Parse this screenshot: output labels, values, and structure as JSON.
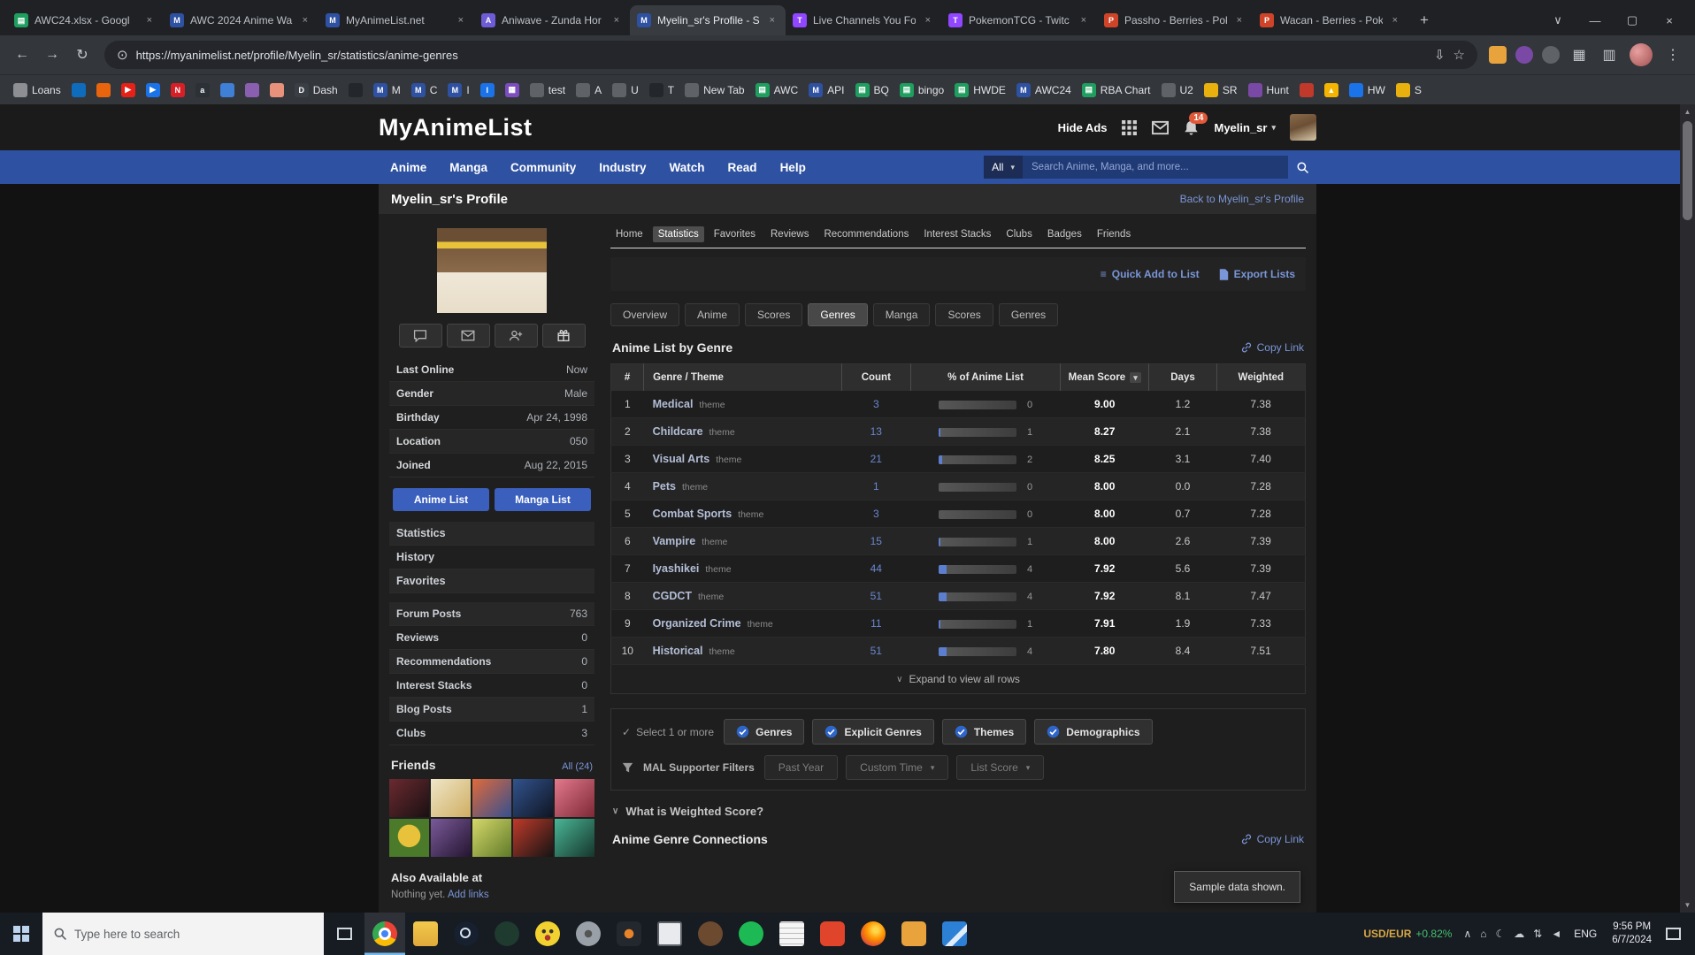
{
  "colors": {
    "mal_blue": "#2e51a2",
    "link_blue": "#7a96d8",
    "count_link": "#6988cf",
    "bar_fill": "#5b7fce",
    "badge_red": "#e05a3a",
    "ticker_gold": "#d9a945",
    "ticker_green": "#45c06e"
  },
  "icons": {
    "tab_search": "∨",
    "minimize": "—",
    "maximize": "▢",
    "close": "×",
    "back": "←",
    "forward": "→",
    "reload": "↻",
    "site_info": "⊙",
    "install": "⇩",
    "bookmark_star": "☆",
    "extensions": "▦",
    "side_panel": "▥",
    "menu": "⋮",
    "new_tab": "+",
    "overflow": "»",
    "caret_down": "▾",
    "chevron_down": "∨",
    "check": "✓",
    "quick_add": "≡",
    "scroll_up": "▲",
    "scroll_down": "▼",
    "tray_chevron": "∧",
    "tray_home": "⌂",
    "tray_moon": "☾",
    "tray_cloud": "☁",
    "tray_net": "⇅",
    "tray_volume": "◄"
  },
  "browser": {
    "tabs": [
      {
        "title": "AWC24.xlsx - Googl",
        "glyph": "▤",
        "color": "#1e9e5f",
        "active": false
      },
      {
        "title": "AWC 2024 Anime Wa",
        "glyph": "M",
        "color": "#2e51a2",
        "active": false
      },
      {
        "title": "MyAnimeList.net",
        "glyph": "M",
        "color": "#2e51a2",
        "active": false
      },
      {
        "title": "Aniwave - Zunda Hor",
        "glyph": "A",
        "color": "#6e5bd6",
        "active": false
      },
      {
        "title": "Myelin_sr's Profile - S",
        "glyph": "M",
        "color": "#2e51a2",
        "active": true
      },
      {
        "title": "Live Channels You Fo",
        "glyph": "T",
        "color": "#9146ff",
        "active": false
      },
      {
        "title": "PokemonTCG - Twitc",
        "glyph": "T",
        "color": "#9146ff",
        "active": false
      },
      {
        "title": "Passho - Berries - Pok",
        "glyph": "P",
        "color": "#cf4428",
        "active": false
      },
      {
        "title": "Wacan - Berries - Pok",
        "glyph": "P",
        "color": "#cf4428",
        "active": false
      }
    ],
    "url": "https://myanimelist.net/profile/Myelin_sr/statistics/anime-genres",
    "bookmarks": [
      {
        "label": "Loans",
        "glyph": "",
        "color": "#8d8f93"
      },
      {
        "label": "",
        "glyph": "",
        "color": "#0f6cbd"
      },
      {
        "label": "",
        "glyph": "",
        "color": "#e8650d"
      },
      {
        "label": "",
        "glyph": "▶",
        "color": "#e62117"
      },
      {
        "label": "",
        "glyph": "▶",
        "color": "#1a73e8"
      },
      {
        "label": "",
        "glyph": "N",
        "color": "#d81f26"
      },
      {
        "label": "",
        "glyph": "a",
        "color": "#2b3137"
      },
      {
        "label": "",
        "glyph": "",
        "color": "#3f7fd6"
      },
      {
        "label": "",
        "glyph": "",
        "color": "#8a5fb0"
      },
      {
        "label": "",
        "glyph": "",
        "color": "#e8927c"
      },
      {
        "label": "Dash",
        "glyph": "D",
        "color": "#3a3f45"
      },
      {
        "label": "",
        "glyph": "",
        "color": "#23272c"
      },
      {
        "label": "M",
        "glyph": "M",
        "color": "#2e51a2"
      },
      {
        "label": "C",
        "glyph": "M",
        "color": "#2e51a2"
      },
      {
        "label": "I",
        "glyph": "M",
        "color": "#2e51a2"
      },
      {
        "label": "",
        "glyph": "I",
        "color": "#1a73e8"
      },
      {
        "label": "",
        "glyph": "▦",
        "color": "#7c4dbe"
      },
      {
        "label": "test",
        "glyph": "",
        "color": "#5f6368"
      },
      {
        "label": "A",
        "glyph": "",
        "color": "#5f6368"
      },
      {
        "label": "U",
        "glyph": "",
        "color": "#5f6368"
      },
      {
        "label": "T",
        "glyph": "",
        "color": "#23272c"
      },
      {
        "label": "New Tab",
        "glyph": "",
        "color": "#5f6368"
      },
      {
        "label": "AWC",
        "glyph": "▤",
        "color": "#1e9e5f"
      },
      {
        "label": "API",
        "glyph": "M",
        "color": "#2e51a2"
      },
      {
        "label": "BQ",
        "glyph": "▤",
        "color": "#1e9e5f"
      },
      {
        "label": "bingo",
        "glyph": "▤",
        "color": "#1e9e5f"
      },
      {
        "label": "HWDE",
        "glyph": "▤",
        "color": "#1e9e5f"
      },
      {
        "label": "AWC24",
        "glyph": "M",
        "color": "#2e51a2"
      },
      {
        "label": "RBA Chart",
        "glyph": "▤",
        "color": "#1e9e5f"
      },
      {
        "label": "U2",
        "glyph": "",
        "color": "#5f6368"
      },
      {
        "label": "SR",
        "glyph": "",
        "color": "#e8b10e"
      },
      {
        "label": "Hunt",
        "glyph": "",
        "color": "#7a49a5"
      },
      {
        "label": "",
        "glyph": "",
        "color": "#c0392b"
      },
      {
        "label": "",
        "glyph": "▲",
        "color": "#f4b400"
      },
      {
        "label": "HW",
        "glyph": "",
        "color": "#1a73e8"
      },
      {
        "label": "S",
        "glyph": "",
        "color": "#e8b10e"
      }
    ],
    "bookmarks_overflow": "»"
  },
  "mal": {
    "header": {
      "logo": "MyAnimeList",
      "hide_ads": "Hide Ads",
      "notif_count": "14",
      "username": "Myelin_sr"
    },
    "nav": {
      "items": [
        "Anime",
        "Manga",
        "Community",
        "Industry",
        "Watch",
        "Read",
        "Help"
      ],
      "search_scope": "All",
      "search_placeholder": "Search Anime, Manga, and more..."
    },
    "profile_bar": {
      "title": "Myelin_sr's Profile",
      "back_link": "Back to Myelin_sr's Profile"
    },
    "sidebar": {
      "stats": [
        {
          "label": "Last Online",
          "value": "Now"
        },
        {
          "label": "Gender",
          "value": "Male"
        },
        {
          "label": "Birthday",
          "value": "Apr 24, 1998"
        },
        {
          "label": "Location",
          "value": "050"
        },
        {
          "label": "Joined",
          "value": "Aug 22, 2015"
        }
      ],
      "anime_list": "Anime List",
      "manga_list": "Manga List",
      "links": [
        "Statistics",
        "History",
        "Favorites"
      ],
      "counts": [
        {
          "label": "Forum Posts",
          "value": "763"
        },
        {
          "label": "Reviews",
          "value": "0"
        },
        {
          "label": "Recommendations",
          "value": "0"
        },
        {
          "label": "Interest Stacks",
          "value": "0"
        },
        {
          "label": "Blog Posts",
          "value": "1"
        },
        {
          "label": "Clubs",
          "value": "3"
        }
      ],
      "friends_title": "Friends",
      "friends_all": "All (24)",
      "also_available": "Also Available at",
      "nothing_yet": "Nothing yet.",
      "add_links": "Add links"
    },
    "profile_tabs": [
      {
        "label": "Home",
        "active": false
      },
      {
        "label": "Statistics",
        "active": true
      },
      {
        "label": "Favorites",
        "active": false
      },
      {
        "label": "Reviews",
        "active": false
      },
      {
        "label": "Recommendations",
        "active": false
      },
      {
        "label": "Interest Stacks",
        "active": false
      },
      {
        "label": "Clubs",
        "active": false
      },
      {
        "label": "Badges",
        "active": false
      },
      {
        "label": "Friends",
        "active": false
      }
    ],
    "toolbar": {
      "quick_add": "Quick Add to List",
      "export": "Export Lists"
    },
    "stat_tabs": [
      {
        "label": "Overview",
        "active": false
      },
      {
        "label": "Anime",
        "active": false
      },
      {
        "label": "Scores",
        "active": false
      },
      {
        "label": "Genres",
        "active": true
      },
      {
        "label": "Manga",
        "active": false
      },
      {
        "label": "Scores",
        "active": false
      },
      {
        "label": "Genres",
        "active": false
      }
    ],
    "genre_section": {
      "title": "Anime List by Genre",
      "copy_link": "Copy Link"
    },
    "table": {
      "headers": [
        "#",
        "Genre / Theme",
        "Count",
        "% of Anime List",
        "Mean Score",
        "Days",
        "Weighted"
      ],
      "rows": [
        {
          "rank": "1",
          "genre": "Medical",
          "tag": "theme",
          "count": "3",
          "percent": 0,
          "mean": "9.00",
          "days": "1.2",
          "weighted": "7.38"
        },
        {
          "rank": "2",
          "genre": "Childcare",
          "tag": "theme",
          "count": "13",
          "percent": 1,
          "mean": "8.27",
          "days": "2.1",
          "weighted": "7.38"
        },
        {
          "rank": "3",
          "genre": "Visual Arts",
          "tag": "theme",
          "count": "21",
          "percent": 2,
          "mean": "8.25",
          "days": "3.1",
          "weighted": "7.40"
        },
        {
          "rank": "4",
          "genre": "Pets",
          "tag": "theme",
          "count": "1",
          "percent": 0,
          "mean": "8.00",
          "days": "0.0",
          "weighted": "7.28"
        },
        {
          "rank": "5",
          "genre": "Combat Sports",
          "tag": "theme",
          "count": "3",
          "percent": 0,
          "mean": "8.00",
          "days": "0.7",
          "weighted": "7.28"
        },
        {
          "rank": "6",
          "genre": "Vampire",
          "tag": "theme",
          "count": "15",
          "percent": 1,
          "mean": "8.00",
          "days": "2.6",
          "weighted": "7.39"
        },
        {
          "rank": "7",
          "genre": "Iyashikei",
          "tag": "theme",
          "count": "44",
          "percent": 4,
          "mean": "7.92",
          "days": "5.6",
          "weighted": "7.39"
        },
        {
          "rank": "8",
          "genre": "CGDCT",
          "tag": "theme",
          "count": "51",
          "percent": 4,
          "mean": "7.92",
          "days": "8.1",
          "weighted": "7.47"
        },
        {
          "rank": "9",
          "genre": "Organized Crime",
          "tag": "theme",
          "count": "11",
          "percent": 1,
          "mean": "7.91",
          "days": "1.9",
          "weighted": "7.33"
        },
        {
          "rank": "10",
          "genre": "Historical",
          "tag": "theme",
          "count": "51",
          "percent": 4,
          "mean": "7.80",
          "days": "8.4",
          "weighted": "7.51"
        }
      ],
      "expand": "Expand to view all rows"
    },
    "filters": {
      "select_label": "Select 1 or more",
      "type_buttons": [
        "Genres",
        "Explicit Genres",
        "Themes",
        "Demographics"
      ],
      "supporter_label": "MAL Supporter Filters",
      "supporter_buttons": [
        {
          "label": "Past Year",
          "caret": false
        },
        {
          "label": "Custom Time",
          "caret": true
        },
        {
          "label": "List Score",
          "caret": true
        }
      ],
      "weighted_question": "What is Weighted Score?"
    },
    "connections": {
      "title": "Anime Genre Connections",
      "copy_link": "Copy Link",
      "sample_note": "Sample data shown."
    }
  },
  "taskbar": {
    "search_placeholder": "Type here to search",
    "apps": [
      "chrome",
      "file-explorer",
      "steam",
      "game",
      "cheat-engine",
      "gear-app",
      "medal",
      "window-app",
      "coffee-app",
      "spotify",
      "notepad",
      "reader-app",
      "firefox",
      "pokemmo",
      "vscode"
    ],
    "ticker_pair": "USD/EUR",
    "ticker_change": "+0.82%",
    "language": "ENG",
    "time": "9:56 PM",
    "date": "6/7/2024"
  }
}
